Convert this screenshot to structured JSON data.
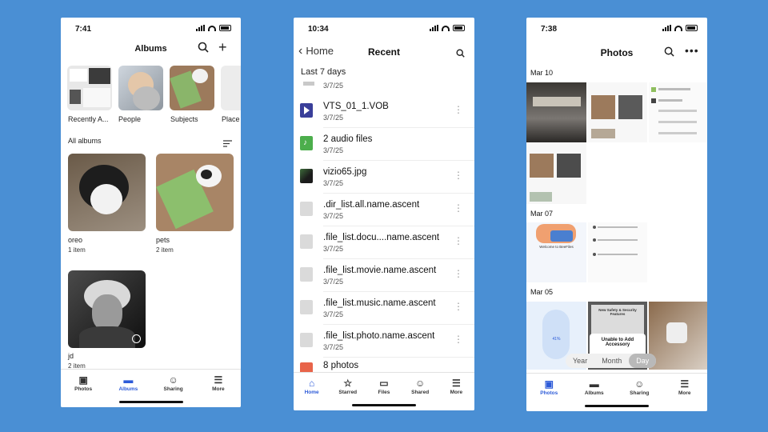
{
  "colors": {
    "background": "#4a8fd4",
    "accent": "#2d5bd8"
  },
  "phone1": {
    "time": "7:41",
    "title": "Albums",
    "icons": [
      "search-icon",
      "plus-icon"
    ],
    "categories": [
      {
        "label": "Recently A..."
      },
      {
        "label": "People"
      },
      {
        "label": "Subjects"
      },
      {
        "label": "Place"
      }
    ],
    "section_label": "All albums",
    "albums": [
      {
        "name": "oreo",
        "count": "1 item"
      },
      {
        "name": "pets",
        "count": "2 item"
      },
      {
        "name": "jd",
        "count": "2 item"
      }
    ],
    "tabs": [
      "Photos",
      "Albums",
      "Sharing",
      "More"
    ],
    "active_tab": "Albums"
  },
  "phone2": {
    "time": "10:34",
    "back_label": "Home",
    "title": "Recent",
    "section": "Last 7 days",
    "first_date": "3/7/25",
    "files": [
      {
        "name": "VTS_01_1.VOB",
        "date": "3/7/25",
        "icon": "video-icon"
      },
      {
        "name": "2 audio files",
        "date": "3/7/25",
        "icon": "audio-icon"
      },
      {
        "name": "vizio65.jpg",
        "date": "3/7/25",
        "icon": "image-icon"
      },
      {
        "name": ".dir_list.all.name.ascent",
        "date": "3/7/25",
        "icon": "file-icon"
      },
      {
        "name": ".file_list.docu....name.ascent",
        "date": "3/7/25",
        "icon": "file-icon"
      },
      {
        "name": ".file_list.movie.name.ascent",
        "date": "3/7/25",
        "icon": "file-icon"
      },
      {
        "name": ".file_list.music.name.ascent",
        "date": "3/7/25",
        "icon": "file-icon"
      },
      {
        "name": ".file_list.photo.name.ascent",
        "date": "3/7/25",
        "icon": "file-icon"
      },
      {
        "name": "8 photos",
        "date": "",
        "icon": "photos-icon"
      }
    ],
    "tabs": [
      "Home",
      "Starred",
      "Files",
      "Shared",
      "More"
    ],
    "active_tab": "Home"
  },
  "phone3": {
    "time": "7:38",
    "title": "Photos",
    "dates": [
      "Mar 10",
      "Mar 07",
      "Mar 05"
    ],
    "shot_texts": {
      "welcome": "Welcome to BeeFiles",
      "unable": "Unable to Add Accessory",
      "features": "New Safety & Security Features",
      "progress": "41%"
    },
    "segments": [
      "Year",
      "Month",
      "Day"
    ],
    "active_segment": "Day",
    "tabs": [
      "Photos",
      "Albums",
      "Sharing",
      "More"
    ],
    "active_tab": "Photos"
  }
}
